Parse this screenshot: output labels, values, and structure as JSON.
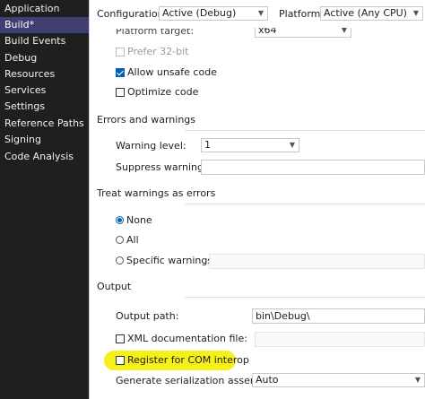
{
  "sidebar": {
    "items": [
      {
        "label": "Application"
      },
      {
        "label": "Build*"
      },
      {
        "label": "Build Events"
      },
      {
        "label": "Debug"
      },
      {
        "label": "Resources"
      },
      {
        "label": "Services"
      },
      {
        "label": "Settings"
      },
      {
        "label": "Reference Paths"
      },
      {
        "label": "Signing"
      },
      {
        "label": "Code Analysis"
      }
    ]
  },
  "toolbar": {
    "configuration_label": "Configuration:",
    "configuration_value": "Active (Debug)",
    "platform_label": "Platform:",
    "platform_value": "Active (Any CPU)"
  },
  "general": {
    "platform_target_label": "Platform target:",
    "platform_target_value": "x64",
    "prefer32_label": "Prefer 32-bit",
    "unsafe_label": "Allow unsafe code",
    "optimize_label": "Optimize code"
  },
  "errors": {
    "header": "Errors and warnings",
    "warning_level_label": "Warning level:",
    "warning_level_value": "1",
    "suppress_label": "Suppress warnings:",
    "suppress_value": ""
  },
  "treat": {
    "header": "Treat warnings as errors",
    "none_label": "None",
    "all_label": "All",
    "specific_label": "Specific warnings:"
  },
  "output": {
    "header": "Output",
    "path_label": "Output path:",
    "path_value": "bin\\Debug\\",
    "xml_label": "XML documentation file:",
    "com_label": "Register for COM interop",
    "serialization_label": "Generate serialization assembly:",
    "serialization_value": "Auto"
  },
  "colors": {
    "sidebar_bg": "#1f1f1f",
    "active_item": "#3f3f74",
    "highlight": "#f5f01a",
    "accent": "#005fb8"
  }
}
